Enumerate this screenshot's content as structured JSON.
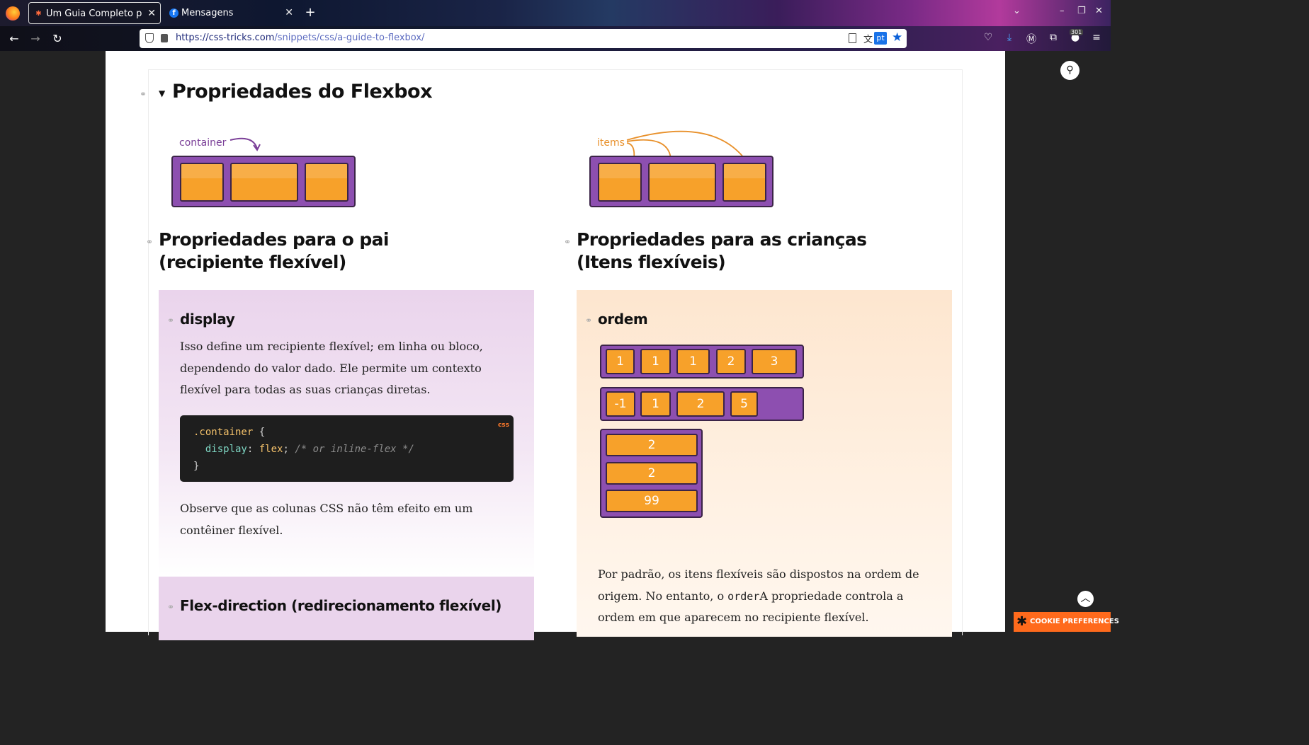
{
  "browser": {
    "tabs": [
      {
        "title": "Um Guia Completo para",
        "favicon": "asterisk-icon"
      },
      {
        "title": "Mensagens",
        "favicon": "facebook-icon"
      }
    ],
    "new_tab_label": "+",
    "url_host": "https://css-tricks.com",
    "url_path": "/snippets/css/a-guide-to-flexbox/",
    "translate_lang": "pt",
    "badge_count": "301"
  },
  "page": {
    "main_heading": "Propriedades do Flexbox",
    "container_label": "container",
    "items_label": "items",
    "parent_heading_line1": "Propriedades para o pai",
    "parent_heading_line2": "(recipiente flexível)",
    "children_heading_line1": "Propriedades para as crianças",
    "children_heading_line2": "(Itens flexíveis)",
    "display": {
      "title": "display",
      "description": "Isso define um recipiente flexível; em linha ou bloco, dependendo do valor dado. Ele permite um contexto flexível para todas as suas crianças diretas.",
      "code_lang": "css",
      "code": {
        "selector": ".container",
        "open": "{",
        "property": "display",
        "value": "flex",
        "comment": "/* or inline-flex */",
        "close": "}"
      },
      "note": "Observe que as colunas CSS não têm efeito em um contêiner flexível."
    },
    "flex_direction_title": "Flex-direction (redirecionamento flexível)",
    "order": {
      "title": "ordem",
      "row1": [
        "1",
        "1",
        "1",
        "2",
        "3"
      ],
      "row2": [
        "-1",
        "1",
        "2",
        "5"
      ],
      "column": [
        "2",
        "2",
        "99"
      ],
      "description_part1": "Por padrão, os itens flexíveis são dispostos na ordem de origem. No entanto, o ",
      "description_code": "order",
      "description_part2": "A propriedade controla a ordem em que aparecem no recipiente flexível."
    },
    "cookie_label": "COOKIE PREFERENCES"
  },
  "colors": {
    "flex_container": "#8d4fb0",
    "flex_item": "#f7a12a",
    "display_section_bg": "#ead4ec",
    "order_section_bg": "#fde6cf"
  }
}
